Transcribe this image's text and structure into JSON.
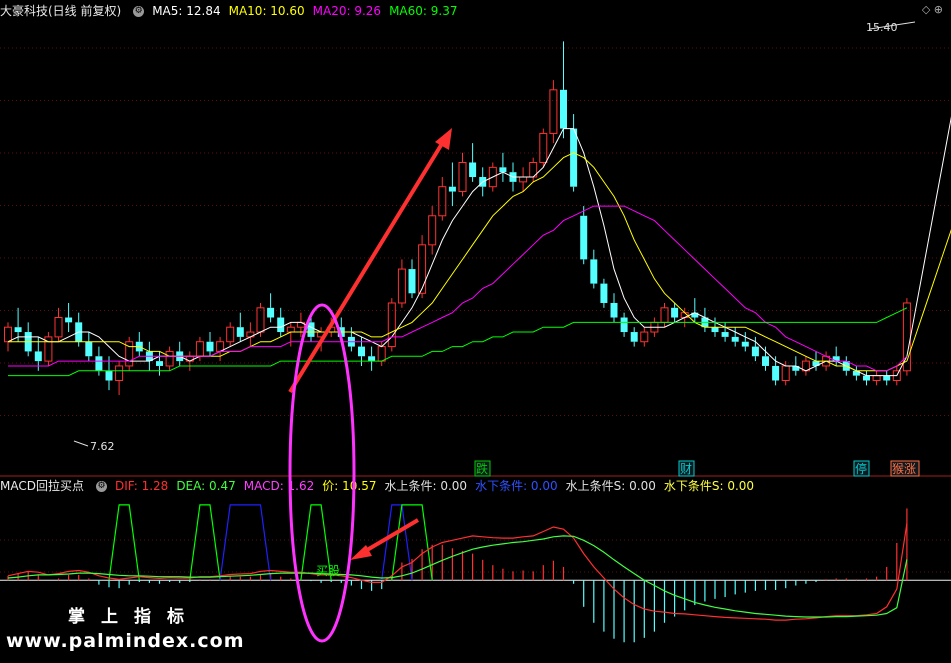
{
  "main_legend": {
    "stock": "大豪科技(日线 前复权)",
    "ma5": "MA5: 12.84",
    "ma10": "MA10: 10.60",
    "ma20": "MA20: 9.26",
    "ma60": "MA60: 9.37",
    "high_label": "15.40",
    "low_label": "7.62"
  },
  "indicator_legend": {
    "name": "MACD回拉买点",
    "dif": "DIF: 1.28",
    "dea": "DEA: 0.47",
    "macd": "MACD: 1.62",
    "price": "价: 10.57",
    "cond_up": "水上条件: 0.00",
    "cond_down": "水下条件: 0.00",
    "cond_up_s": "水上条件S: 0.00",
    "cond_down_s": "水下条件S: 0.00"
  },
  "markers": [
    "跌",
    "财",
    "停",
    "猴涨"
  ],
  "signal_label": "买股",
  "watermark": {
    "cn": "掌上指标",
    "url": "www.palmindex.com"
  },
  "colors": {
    "up": "#ff3232",
    "down": "#54ffff",
    "ma5": "#ffffff",
    "ma10": "#ffff00",
    "ma20": "#ff00ff",
    "ma60": "#00ff00",
    "dif": "#ff3030",
    "dea": "#40ff40",
    "annot": "#ff3030",
    "ellipse": "#ff33ff"
  },
  "chart_data": [
    {
      "type": "candlestick",
      "ylim": [
        6.8,
        15.8
      ],
      "candles": [
        [
          9.2,
          9.6,
          9.0,
          9.5
        ],
        [
          9.5,
          9.9,
          9.2,
          9.4
        ],
        [
          9.4,
          9.6,
          8.9,
          9.0
        ],
        [
          9.0,
          9.3,
          8.6,
          8.8
        ],
        [
          8.8,
          9.4,
          8.7,
          9.3
        ],
        [
          9.3,
          9.9,
          9.2,
          9.7
        ],
        [
          9.7,
          10.0,
          9.4,
          9.6
        ],
        [
          9.6,
          9.8,
          9.1,
          9.2
        ],
        [
          9.2,
          9.4,
          8.8,
          8.9
        ],
        [
          8.9,
          9.1,
          8.5,
          8.6
        ],
        [
          8.6,
          8.9,
          8.2,
          8.4
        ],
        [
          8.4,
          8.8,
          8.1,
          8.7
        ],
        [
          8.7,
          9.3,
          8.6,
          9.2
        ],
        [
          9.2,
          9.4,
          8.9,
          9.0
        ],
        [
          9.0,
          9.2,
          8.6,
          8.8
        ],
        [
          8.8,
          9.0,
          8.5,
          8.7
        ],
        [
          8.7,
          9.1,
          8.6,
          9.0
        ],
        [
          9.0,
          9.2,
          8.7,
          8.8
        ],
        [
          8.8,
          9.0,
          8.6,
          8.9
        ],
        [
          8.9,
          9.3,
          8.8,
          9.2
        ],
        [
          9.2,
          9.4,
          8.9,
          9.0
        ],
        [
          9.0,
          9.3,
          8.8,
          9.2
        ],
        [
          9.2,
          9.6,
          9.1,
          9.5
        ],
        [
          9.5,
          9.8,
          9.2,
          9.3
        ],
        [
          9.3,
          9.6,
          9.1,
          9.4
        ],
        [
          9.4,
          10.0,
          9.3,
          9.9
        ],
        [
          9.9,
          10.2,
          9.6,
          9.7
        ],
        [
          9.7,
          9.9,
          9.3,
          9.4
        ],
        [
          9.4,
          9.6,
          9.1,
          9.5
        ],
        [
          9.5,
          9.8,
          9.3,
          9.6
        ],
        [
          9.6,
          9.8,
          9.2,
          9.3
        ],
        [
          9.3,
          9.5,
          9.0,
          9.4
        ],
        [
          9.4,
          9.7,
          9.3,
          9.5
        ],
        [
          9.5,
          9.7,
          9.2,
          9.3
        ],
        [
          9.3,
          9.5,
          9.0,
          9.1
        ],
        [
          9.1,
          9.3,
          8.7,
          8.9
        ],
        [
          8.9,
          9.1,
          8.6,
          8.8
        ],
        [
          8.8,
          9.2,
          8.7,
          9.1
        ],
        [
          9.1,
          10.1,
          9.0,
          10.0
        ],
        [
          10.0,
          10.9,
          9.9,
          10.7
        ],
        [
          10.7,
          10.9,
          10.1,
          10.2
        ],
        [
          10.2,
          11.4,
          10.1,
          11.2
        ],
        [
          11.2,
          12.0,
          11.0,
          11.8
        ],
        [
          11.8,
          12.6,
          11.7,
          12.4
        ],
        [
          12.4,
          12.9,
          12.0,
          12.3
        ],
        [
          12.3,
          13.1,
          12.2,
          12.9
        ],
        [
          12.9,
          13.3,
          12.5,
          12.6
        ],
        [
          12.6,
          12.8,
          12.2,
          12.4
        ],
        [
          12.4,
          12.9,
          12.3,
          12.8
        ],
        [
          12.8,
          13.1,
          12.5,
          12.7
        ],
        [
          12.7,
          12.9,
          12.3,
          12.5
        ],
        [
          12.5,
          12.8,
          12.3,
          12.6
        ],
        [
          12.6,
          13.0,
          12.5,
          12.9
        ],
        [
          12.9,
          13.6,
          12.8,
          13.5
        ],
        [
          13.5,
          14.6,
          13.3,
          14.4
        ],
        [
          14.4,
          15.4,
          13.4,
          13.6
        ],
        [
          13.6,
          13.9,
          12.3,
          12.4
        ],
        [
          11.8,
          12.0,
          10.8,
          10.9
        ],
        [
          10.9,
          11.1,
          10.3,
          10.4
        ],
        [
          10.4,
          10.5,
          9.9,
          10.0
        ],
        [
          10.0,
          10.2,
          9.6,
          9.7
        ],
        [
          9.7,
          9.8,
          9.3,
          9.4
        ],
        [
          9.4,
          9.5,
          9.1,
          9.2
        ],
        [
          9.2,
          9.5,
          9.1,
          9.4
        ],
        [
          9.4,
          9.7,
          9.3,
          9.6
        ],
        [
          9.6,
          10.0,
          9.5,
          9.9
        ],
        [
          9.9,
          10.0,
          9.6,
          9.7
        ],
        [
          9.7,
          9.9,
          9.5,
          9.8
        ],
        [
          9.8,
          10.1,
          9.6,
          9.7
        ],
        [
          9.7,
          9.9,
          9.4,
          9.5
        ],
        [
          9.5,
          9.7,
          9.3,
          9.4
        ],
        [
          9.4,
          9.6,
          9.2,
          9.3
        ],
        [
          9.3,
          9.5,
          9.1,
          9.2
        ],
        [
          9.2,
          9.4,
          9.0,
          9.1
        ],
        [
          9.1,
          9.3,
          8.8,
          8.9
        ],
        [
          8.9,
          9.1,
          8.6,
          8.7
        ],
        [
          8.7,
          8.9,
          8.3,
          8.4
        ],
        [
          8.4,
          8.8,
          8.3,
          8.7
        ],
        [
          8.7,
          8.9,
          8.5,
          8.6
        ],
        [
          8.6,
          8.9,
          8.5,
          8.8
        ],
        [
          8.8,
          9.0,
          8.6,
          8.7
        ],
        [
          8.7,
          9.0,
          8.6,
          8.9
        ],
        [
          8.9,
          9.1,
          8.7,
          8.8
        ],
        [
          8.8,
          8.9,
          8.5,
          8.6
        ],
        [
          8.6,
          8.7,
          8.4,
          8.5
        ],
        [
          8.5,
          8.6,
          8.3,
          8.4
        ],
        [
          8.4,
          8.6,
          8.3,
          8.5
        ],
        [
          8.5,
          8.6,
          8.3,
          8.4
        ],
        [
          8.4,
          8.7,
          8.3,
          8.6
        ],
        [
          8.6,
          10.1,
          8.5,
          10.0
        ]
      ],
      "ma_series": [
        {
          "name": "MA5",
          "values": [
            9.2,
            9.3,
            9.3,
            9.3,
            9.2,
            9.2,
            9.3,
            9.4,
            9.4,
            9.3,
            9.1,
            8.9,
            8.8,
            8.8,
            8.8,
            8.9,
            8.9,
            8.9,
            8.8,
            8.9,
            8.9,
            9.0,
            9.1,
            9.2,
            9.3,
            9.4,
            9.5,
            9.5,
            9.6,
            9.6,
            9.5,
            9.4,
            9.4,
            9.4,
            9.4,
            9.3,
            9.2,
            9.1,
            9.3,
            9.6,
            9.9,
            10.3,
            10.8,
            11.3,
            11.7,
            12.0,
            12.3,
            12.5,
            12.6,
            12.7,
            12.6,
            12.6,
            12.6,
            12.8,
            13.2,
            13.6,
            13.6,
            13.1,
            12.4,
            11.6,
            10.7,
            10.1,
            9.7,
            9.5,
            9.5,
            9.5,
            9.6,
            9.7,
            9.8,
            9.7,
            9.6,
            9.5,
            9.4,
            9.3,
            9.2,
            9.0,
            8.8,
            8.7,
            8.7,
            8.6,
            8.7,
            8.8,
            8.8,
            8.7,
            8.6,
            8.5,
            8.5,
            8.5,
            8.5,
            8.9
          ]
        },
        {
          "name": "MA10",
          "values": [
            9.2,
            9.2,
            9.2,
            9.2,
            9.2,
            9.2,
            9.2,
            9.2,
            9.2,
            9.2,
            9.2,
            9.2,
            9.1,
            9.1,
            9.0,
            9.0,
            8.9,
            8.9,
            8.9,
            8.9,
            8.9,
            8.9,
            9.0,
            9.0,
            9.1,
            9.2,
            9.2,
            9.3,
            9.4,
            9.4,
            9.4,
            9.4,
            9.4,
            9.4,
            9.4,
            9.4,
            9.3,
            9.3,
            9.4,
            9.5,
            9.6,
            9.8,
            10.0,
            10.3,
            10.6,
            10.9,
            11.2,
            11.5,
            11.8,
            12.0,
            12.2,
            12.3,
            12.5,
            12.6,
            12.8,
            13.0,
            13.1,
            13.0,
            12.8,
            12.5,
            12.2,
            11.8,
            11.3,
            10.9,
            10.5,
            10.2,
            10.0,
            9.8,
            9.6,
            9.5,
            9.5,
            9.5,
            9.5,
            9.5,
            9.4,
            9.3,
            9.2,
            9.1,
            9.0,
            8.9,
            8.8,
            8.8,
            8.7,
            8.7,
            8.6,
            8.6,
            8.6,
            8.6,
            8.7,
            8.8
          ]
        },
        {
          "name": "MA20",
          "values": [
            8.7,
            8.7,
            8.7,
            8.7,
            8.7,
            8.8,
            8.8,
            8.8,
            8.8,
            8.8,
            8.8,
            8.8,
            8.8,
            8.9,
            8.9,
            8.9,
            8.9,
            8.9,
            8.9,
            8.9,
            8.9,
            9.0,
            9.0,
            9.0,
            9.1,
            9.1,
            9.1,
            9.1,
            9.2,
            9.2,
            9.2,
            9.2,
            9.2,
            9.2,
            9.2,
            9.2,
            9.2,
            9.2,
            9.3,
            9.3,
            9.4,
            9.5,
            9.6,
            9.7,
            9.8,
            10.0,
            10.1,
            10.3,
            10.4,
            10.6,
            10.8,
            11.0,
            11.2,
            11.4,
            11.5,
            11.7,
            11.8,
            11.9,
            12.0,
            12.0,
            12.0,
            12.0,
            11.9,
            11.8,
            11.7,
            11.5,
            11.3,
            11.1,
            10.9,
            10.7,
            10.5,
            10.3,
            10.1,
            9.9,
            9.8,
            9.6,
            9.5,
            9.3,
            9.2,
            9.1,
            9.0,
            8.9,
            8.8,
            8.8,
            8.7,
            8.7,
            8.6,
            8.6,
            8.7,
            8.9
          ]
        },
        {
          "name": "MA60",
          "values": [
            8.5,
            8.5,
            8.5,
            8.5,
            8.5,
            8.5,
            8.5,
            8.6,
            8.6,
            8.6,
            8.6,
            8.6,
            8.6,
            8.6,
            8.6,
            8.6,
            8.6,
            8.7,
            8.7,
            8.7,
            8.7,
            8.7,
            8.7,
            8.7,
            8.7,
            8.7,
            8.7,
            8.8,
            8.8,
            8.8,
            8.8,
            8.8,
            8.8,
            8.8,
            8.8,
            8.8,
            8.8,
            8.8,
            8.9,
            8.9,
            8.9,
            8.9,
            9.0,
            9.0,
            9.1,
            9.1,
            9.2,
            9.2,
            9.3,
            9.3,
            9.4,
            9.4,
            9.4,
            9.5,
            9.5,
            9.5,
            9.6,
            9.6,
            9.6,
            9.6,
            9.6,
            9.6,
            9.6,
            9.6,
            9.6,
            9.6,
            9.6,
            9.6,
            9.6,
            9.6,
            9.6,
            9.6,
            9.6,
            9.6,
            9.6,
            9.6,
            9.6,
            9.6,
            9.6,
            9.6,
            9.6,
            9.6,
            9.6,
            9.6,
            9.6,
            9.6,
            9.6,
            9.7,
            9.8,
            9.9
          ]
        }
      ]
    },
    {
      "type": "macd",
      "ylim": [
        -1.8,
        1.9
      ],
      "dif": [
        0.1,
        0.15,
        0.2,
        0.18,
        0.12,
        0.15,
        0.2,
        0.22,
        0.18,
        0.1,
        0.05,
        0.02,
        0.05,
        0.08,
        0.06,
        0.04,
        0.06,
        0.05,
        0.05,
        0.08,
        0.08,
        0.1,
        0.13,
        0.14,
        0.15,
        0.2,
        0.22,
        0.2,
        0.18,
        0.18,
        0.15,
        0.12,
        0.12,
        0.1,
        0.06,
        0.0,
        -0.05,
        -0.05,
        0.1,
        0.3,
        0.4,
        0.6,
        0.75,
        0.85,
        0.9,
        0.95,
        1.0,
        0.98,
        0.96,
        0.95,
        0.95,
        0.98,
        1.0,
        1.1,
        1.2,
        1.15,
        0.95,
        0.6,
        0.3,
        0.05,
        -0.2,
        -0.4,
        -0.55,
        -0.65,
        -0.7,
        -0.72,
        -0.75,
        -0.76,
        -0.78,
        -0.8,
        -0.82,
        -0.84,
        -0.85,
        -0.86,
        -0.87,
        -0.88,
        -0.9,
        -0.9,
        -0.88,
        -0.87,
        -0.85,
        -0.82,
        -0.8,
        -0.8,
        -0.8,
        -0.78,
        -0.75,
        -0.6,
        -0.2,
        1.28
      ],
      "dea": [
        0.05,
        0.07,
        0.1,
        0.12,
        0.12,
        0.13,
        0.14,
        0.16,
        0.16,
        0.15,
        0.13,
        0.11,
        0.1,
        0.1,
        0.09,
        0.08,
        0.08,
        0.08,
        0.07,
        0.07,
        0.07,
        0.08,
        0.09,
        0.1,
        0.11,
        0.13,
        0.15,
        0.16,
        0.16,
        0.16,
        0.16,
        0.15,
        0.14,
        0.13,
        0.12,
        0.1,
        0.07,
        0.05,
        0.06,
        0.1,
        0.16,
        0.25,
        0.35,
        0.45,
        0.54,
        0.62,
        0.7,
        0.75,
        0.79,
        0.82,
        0.85,
        0.87,
        0.9,
        0.93,
        0.98,
        1.0,
        0.99,
        0.9,
        0.78,
        0.63,
        0.46,
        0.3,
        0.15,
        0.0,
        -0.12,
        -0.24,
        -0.34,
        -0.42,
        -0.5,
        -0.56,
        -0.61,
        -0.65,
        -0.69,
        -0.72,
        -0.75,
        -0.77,
        -0.79,
        -0.81,
        -0.82,
        -0.83,
        -0.83,
        -0.83,
        -0.82,
        -0.82,
        -0.81,
        -0.8,
        -0.79,
        -0.75,
        -0.62,
        0.47
      ],
      "macd": [
        0.1,
        0.16,
        0.2,
        0.12,
        0.0,
        0.04,
        0.12,
        0.12,
        0.04,
        -0.1,
        -0.16,
        -0.18,
        -0.1,
        -0.04,
        -0.06,
        -0.08,
        -0.04,
        -0.06,
        -0.04,
        0.02,
        0.02,
        0.04,
        0.08,
        0.08,
        0.08,
        0.14,
        0.14,
        0.08,
        0.04,
        0.04,
        -0.02,
        -0.06,
        -0.04,
        -0.06,
        -0.12,
        -0.2,
        -0.24,
        -0.2,
        0.08,
        0.4,
        0.48,
        0.7,
        0.8,
        0.8,
        0.72,
        0.66,
        0.6,
        0.46,
        0.34,
        0.26,
        0.2,
        0.22,
        0.2,
        0.34,
        0.44,
        0.3,
        -0.08,
        -0.6,
        -0.96,
        -1.16,
        -1.32,
        -1.4,
        -1.4,
        -1.3,
        -1.16,
        -0.96,
        -0.82,
        -0.68,
        -0.56,
        -0.48,
        -0.42,
        -0.38,
        -0.32,
        -0.28,
        -0.24,
        -0.22,
        -0.22,
        -0.18,
        -0.12,
        -0.08,
        -0.04,
        0.02,
        0.04,
        0.04,
        0.02,
        0.04,
        0.08,
        0.3,
        0.84,
        1.62
      ],
      "condition_steps": [
        {
          "start": 10,
          "end": 13,
          "color": "#00ff00"
        },
        {
          "start": 18,
          "end": 21,
          "color": "#00ff00"
        },
        {
          "start": 21,
          "end": 26,
          "color": "#2020ff"
        },
        {
          "start": 29,
          "end": 32,
          "color": "#00ff00"
        },
        {
          "start": 37,
          "end": 40,
          "color": "#2020ff"
        },
        {
          "start": 38,
          "end": 42,
          "color": "#00ff00"
        }
      ]
    }
  ]
}
